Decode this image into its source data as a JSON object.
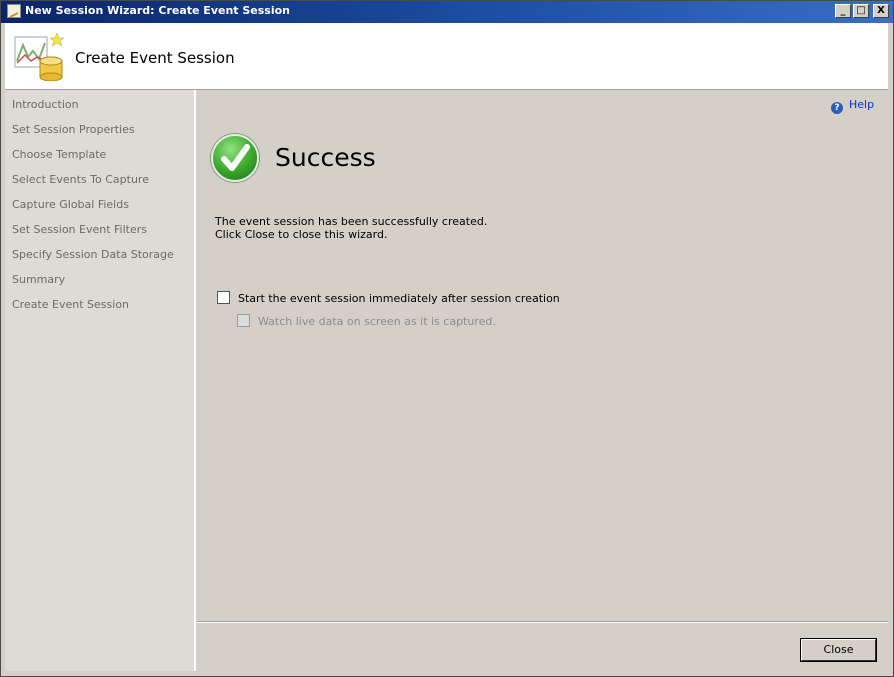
{
  "window": {
    "title": "New Session Wizard: Create Event Session",
    "min_glyph": "_",
    "max_glyph": "□",
    "close_glyph": "X"
  },
  "header": {
    "title": "Create Event Session",
    "icon": "event-session-chart-icon"
  },
  "sidebar": {
    "items": [
      {
        "label": "Introduction"
      },
      {
        "label": "Set Session Properties"
      },
      {
        "label": "Choose Template"
      },
      {
        "label": "Select Events To Capture"
      },
      {
        "label": "Capture Global Fields"
      },
      {
        "label": "Set Session Event Filters"
      },
      {
        "label": "Specify Session Data Storage"
      },
      {
        "label": "Summary"
      },
      {
        "label": "Create Event Session"
      }
    ]
  },
  "main": {
    "help_label": "Help",
    "status_title": "Success",
    "status_icon": "success-check-icon",
    "message_line1": "The event session has been successfully created.",
    "message_line2": "Click Close to close this wizard.",
    "start_session_label": "Start the event session immediately after session creation",
    "start_session_checked": false,
    "watch_live_label": "Watch live data on screen as it is captured.",
    "watch_live_checked": false,
    "watch_live_enabled": false
  },
  "footer": {
    "close_label": "Close"
  },
  "colors": {
    "titlebar": "#0a246a",
    "dialog_bg": "#d4d0c8",
    "help_link": "#0033cc",
    "success_green": "#3aa52c"
  }
}
